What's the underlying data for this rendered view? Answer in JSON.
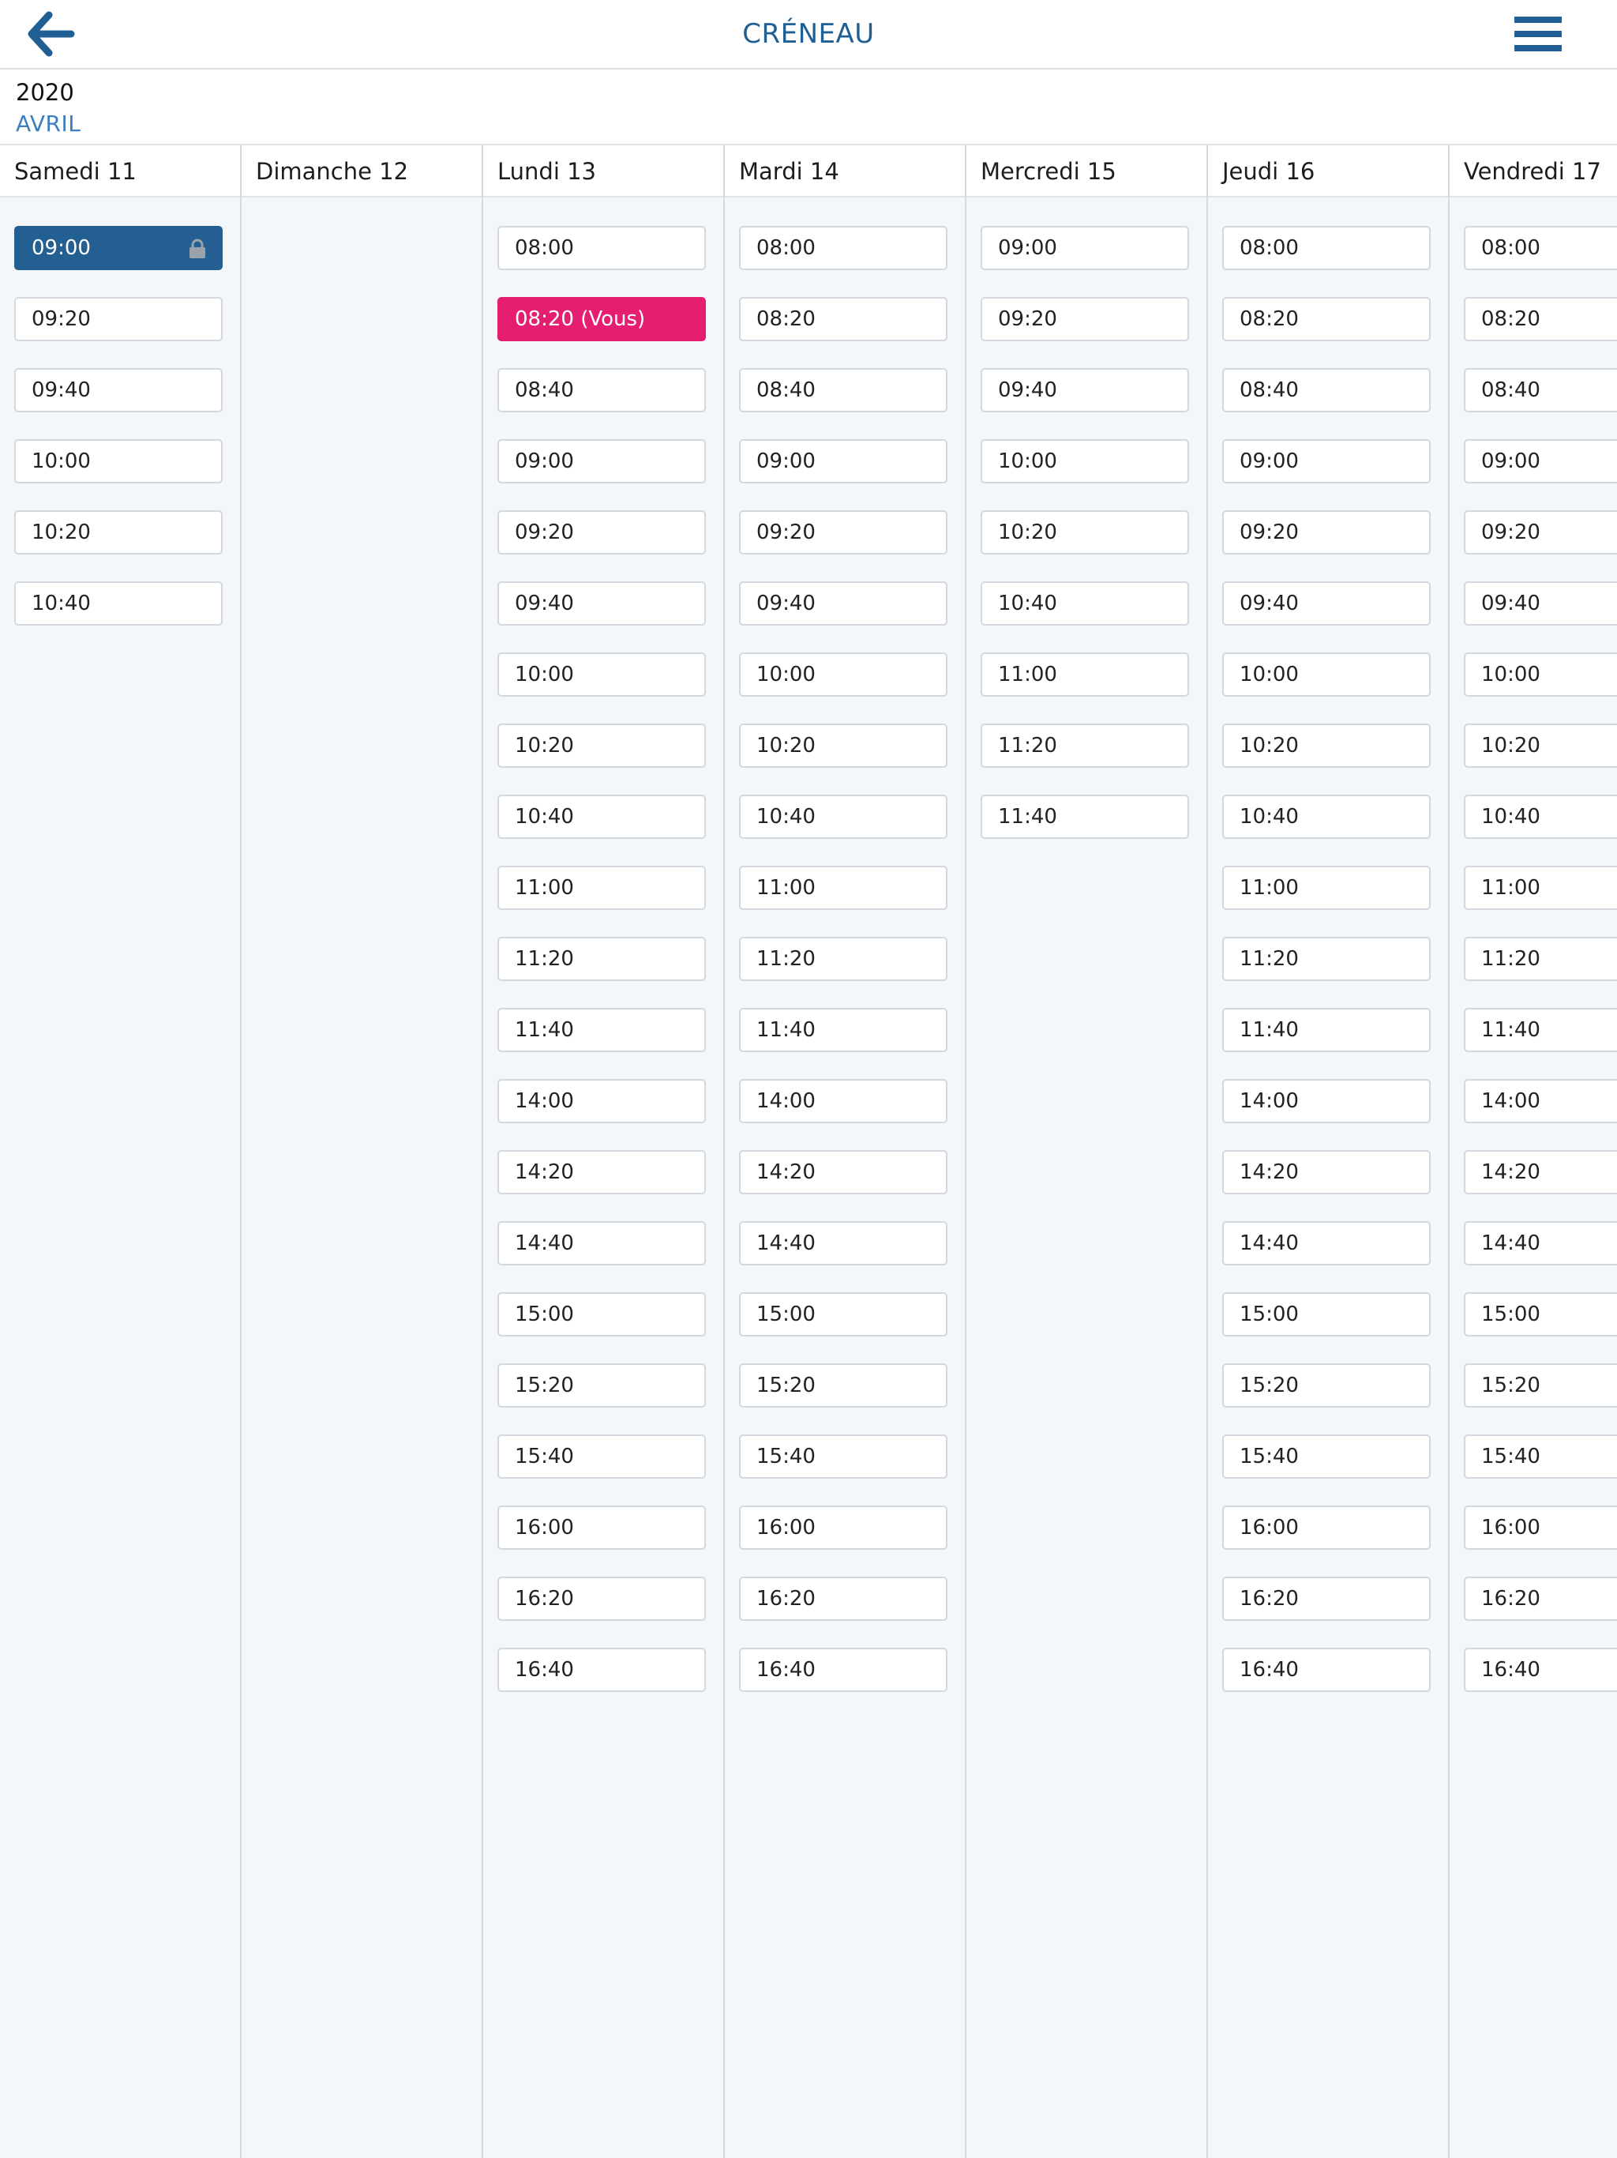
{
  "header": {
    "title": "CRÉNEAU",
    "back_icon": "arrow-left-icon",
    "menu_icon": "hamburger-menu-icon",
    "accent_color": "#1f5f94"
  },
  "date": {
    "year": "2020",
    "month": "AVRIL"
  },
  "days": [
    {
      "label": "Samedi 11",
      "slots": [
        {
          "time": "09:00",
          "state": "locked"
        },
        {
          "time": "09:20"
        },
        {
          "time": "09:40"
        },
        {
          "time": "10:00"
        },
        {
          "time": "10:20"
        },
        {
          "time": "10:40"
        }
      ]
    },
    {
      "label": "Dimanche 12",
      "slots": []
    },
    {
      "label": "Lundi 13",
      "slots": [
        {
          "time": "08:00"
        },
        {
          "time": "08:20 (Vous)",
          "state": "mine"
        },
        {
          "time": "08:40"
        },
        {
          "time": "09:00"
        },
        {
          "time": "09:20"
        },
        {
          "time": "09:40"
        },
        {
          "time": "10:00"
        },
        {
          "time": "10:20"
        },
        {
          "time": "10:40"
        },
        {
          "time": "11:00"
        },
        {
          "time": "11:20"
        },
        {
          "time": "11:40"
        },
        {
          "time": "14:00"
        },
        {
          "time": "14:20"
        },
        {
          "time": "14:40"
        },
        {
          "time": "15:00"
        },
        {
          "time": "15:20"
        },
        {
          "time": "15:40"
        },
        {
          "time": "16:00"
        },
        {
          "time": "16:20"
        },
        {
          "time": "16:40"
        }
      ]
    },
    {
      "label": "Mardi 14",
      "slots": [
        {
          "time": "08:00"
        },
        {
          "time": "08:20"
        },
        {
          "time": "08:40"
        },
        {
          "time": "09:00"
        },
        {
          "time": "09:20"
        },
        {
          "time": "09:40"
        },
        {
          "time": "10:00"
        },
        {
          "time": "10:20"
        },
        {
          "time": "10:40"
        },
        {
          "time": "11:00"
        },
        {
          "time": "11:20"
        },
        {
          "time": "11:40"
        },
        {
          "time": "14:00"
        },
        {
          "time": "14:20"
        },
        {
          "time": "14:40"
        },
        {
          "time": "15:00"
        },
        {
          "time": "15:20"
        },
        {
          "time": "15:40"
        },
        {
          "time": "16:00"
        },
        {
          "time": "16:20"
        },
        {
          "time": "16:40"
        }
      ]
    },
    {
      "label": "Mercredi 15",
      "slots": [
        {
          "time": "09:00"
        },
        {
          "time": "09:20"
        },
        {
          "time": "09:40"
        },
        {
          "time": "10:00"
        },
        {
          "time": "10:20"
        },
        {
          "time": "10:40"
        },
        {
          "time": "11:00"
        },
        {
          "time": "11:20"
        },
        {
          "time": "11:40"
        }
      ]
    },
    {
      "label": "Jeudi 16",
      "slots": [
        {
          "time": "08:00"
        },
        {
          "time": "08:20"
        },
        {
          "time": "08:40"
        },
        {
          "time": "09:00"
        },
        {
          "time": "09:20"
        },
        {
          "time": "09:40"
        },
        {
          "time": "10:00"
        },
        {
          "time": "10:20"
        },
        {
          "time": "10:40"
        },
        {
          "time": "11:00"
        },
        {
          "time": "11:20"
        },
        {
          "time": "11:40"
        },
        {
          "time": "14:00"
        },
        {
          "time": "14:20"
        },
        {
          "time": "14:40"
        },
        {
          "time": "15:00"
        },
        {
          "time": "15:20"
        },
        {
          "time": "15:40"
        },
        {
          "time": "16:00"
        },
        {
          "time": "16:20"
        },
        {
          "time": "16:40"
        }
      ]
    },
    {
      "label": "Vendredi 17",
      "slots": [
        {
          "time": "08:00"
        },
        {
          "time": "08:20"
        },
        {
          "time": "08:40"
        },
        {
          "time": "09:00"
        },
        {
          "time": "09:20"
        },
        {
          "time": "09:40"
        },
        {
          "time": "10:00"
        },
        {
          "time": "10:20"
        },
        {
          "time": "10:40"
        },
        {
          "time": "11:00"
        },
        {
          "time": "11:20"
        },
        {
          "time": "11:40"
        },
        {
          "time": "14:00"
        },
        {
          "time": "14:20"
        },
        {
          "time": "14:40"
        },
        {
          "time": "15:00"
        },
        {
          "time": "15:20"
        },
        {
          "time": "15:40"
        },
        {
          "time": "16:00"
        },
        {
          "time": "16:20"
        },
        {
          "time": "16:40"
        }
      ]
    }
  ]
}
